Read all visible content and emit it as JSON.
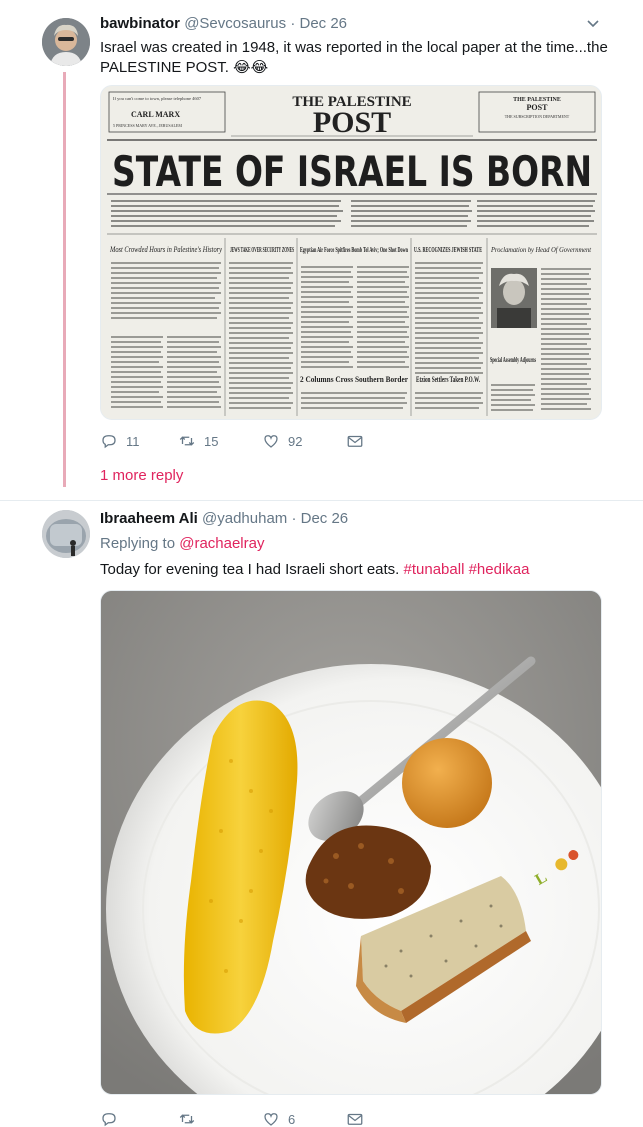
{
  "tweets": [
    {
      "name": "bawbinator",
      "handle": "@Sevcosaurus",
      "separator": "·",
      "date": "Dec 26",
      "text": "Israel was created in 1948, it was reported in the local paper at the time...the PALESTINE POST.",
      "emoji": "😂😂",
      "media": {
        "kind": "newspaper",
        "masthead_line1": "THE PALESTINE",
        "masthead_line2": "POST",
        "headline": "STATE OF ISRAEL IS BORN",
        "left_ad": [
          "If you can't come to town, please telephone 4607",
          "CARL MARX",
          "5 PRINCESS MARY AVE., JERUSALEM"
        ],
        "right_box": [
          "THE PALESTINE",
          "POST",
          "THE SUBSCRIPTION DEPARTMENT"
        ],
        "subheads": [
          "Most Crowded Hours in Palestine's History",
          "JEWS TAKE OVER SECURITY ZONES",
          "Egyptian Air Force Spitfires Bomb Tel Aviv; One Shot Down",
          "U.S. RECOGNIZES JEWISH STATE",
          "Proclamation by Head Of Government",
          "2 Columns Cross Southern Border",
          "Etzion Settlers Taken P.O.W.",
          "Special Assembly Adjourns"
        ]
      },
      "actions": {
        "replies": "11",
        "retweets": "15",
        "likes": "92"
      },
      "more_reply": "1 more reply"
    },
    {
      "name": "Ibraaheem Ali",
      "handle": "@yadhuham",
      "separator": "·",
      "date": "Dec 26",
      "replying_prefix": "Replying to",
      "replying_to": "@rachaelray",
      "text": "Today for evening tea I had Israeli short eats.",
      "hashtag1": "#tunaball",
      "hashtag2": "#hedikaa",
      "media": {
        "kind": "food-photo"
      },
      "actions": {
        "replies": "",
        "retweets": "",
        "likes": "6"
      }
    }
  ],
  "colors": {
    "accent": "#e0245e",
    "thread": "#e8aab8",
    "muted": "#657786"
  },
  "icons": [
    "reply-icon",
    "retweet-icon",
    "like-icon",
    "dm-icon",
    "caret-down-icon"
  ]
}
